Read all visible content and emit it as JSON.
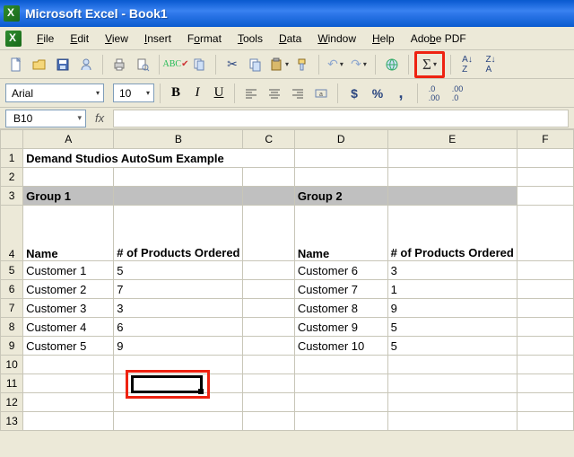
{
  "app": {
    "title": "Microsoft Excel - Book1"
  },
  "menu": {
    "file": "File",
    "edit": "Edit",
    "view": "View",
    "insert": "Insert",
    "format": "Format",
    "tools": "Tools",
    "data": "Data",
    "window": "Window",
    "help": "Help",
    "adobe": "Adobe PDF"
  },
  "format_toolbar": {
    "font": "Arial",
    "size": "10",
    "bold": "B",
    "italic": "I",
    "underline": "U",
    "currency": "$",
    "percent": "%",
    "comma": ","
  },
  "namebox": {
    "value": "B10"
  },
  "formula": {
    "fx": "fx",
    "value": ""
  },
  "columns": [
    "A",
    "B",
    "C",
    "D",
    "E",
    "F"
  ],
  "rows": [
    "1",
    "2",
    "3",
    "4",
    "5",
    "6",
    "7",
    "8",
    "9",
    "10",
    "11",
    "12",
    "13"
  ],
  "cells": {
    "A1": "Demand Studios AutoSum Example",
    "A3": "Group 1",
    "D3": "Group 2",
    "A4": "Name",
    "B4": "# of Products Ordered",
    "D4": "Name",
    "E4": "# of Products Ordered",
    "A5": "Customer 1",
    "B5": "5",
    "D5": "Customer 6",
    "E5": "3",
    "A6": "Customer 2",
    "B6": "7",
    "D6": "Customer 7",
    "E6": "1",
    "A7": "Customer 3",
    "B7": "3",
    "D7": "Customer 8",
    "E7": "9",
    "A8": "Customer 4",
    "B8": "6",
    "D8": "Customer 9",
    "E8": "5",
    "A9": "Customer 5",
    "B9": "9",
    "D9": "Customer 10",
    "E9": "5"
  },
  "active_cell": "B10",
  "highlights": {
    "autosum_button": true,
    "cell_B10": true
  }
}
